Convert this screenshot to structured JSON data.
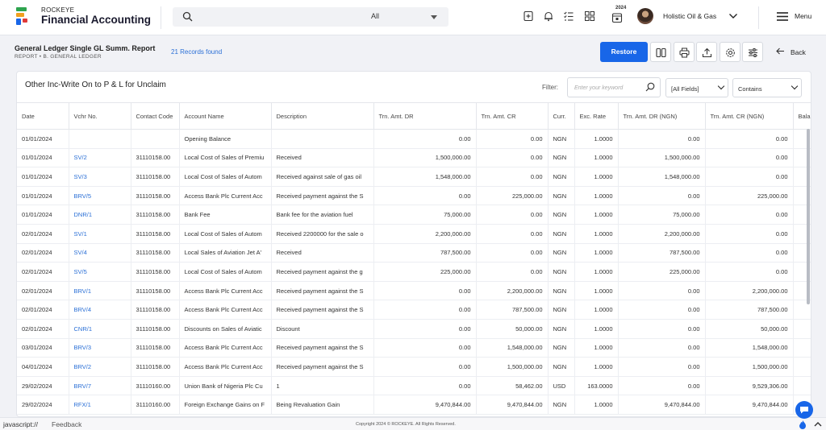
{
  "app": {
    "company_small": "ROCKEYE",
    "name": "Financial Accounting"
  },
  "search": {
    "filter_value": "All"
  },
  "header": {
    "year": "2024",
    "company": "Holistic Oil & Gas",
    "menu_label": "Menu"
  },
  "page": {
    "title": "General Ledger Single GL Summ. Report",
    "breadcrumb": "REPORT  •  B. GENERAL LEDGER",
    "records": "21 Records found",
    "restore_label": "Restore",
    "back_label": "Back"
  },
  "report": {
    "title": "Other Inc-Write On to P & L for Unclaim",
    "filter_label": "Filter:",
    "filter_placeholder": "Enter your keyword",
    "field_select": "[All Fields]",
    "match_select": "Contains"
  },
  "table": {
    "columns": [
      "Date",
      "Vchr No.",
      "Contact Code",
      "Account Name",
      "Description",
      "Trn. Amt. DR",
      "Trn. Amt. CR",
      "Curr.",
      "Exc. Rate",
      "Trn. Amt. DR (NGN)",
      "Trn. Amt. CR (NGN)",
      "Balar"
    ],
    "rows": [
      [
        "01/01/2024",
        "",
        "",
        "Opening Balance",
        "",
        "0.00",
        "0.00",
        "NGN",
        "1.0000",
        "0.00",
        "0.00"
      ],
      [
        "01/01/2024",
        "SV/2",
        "31110158.00",
        "Local Cost of Sales of Premiu",
        "Received",
        "1,500,000.00",
        "0.00",
        "NGN",
        "1.0000",
        "1,500,000.00",
        "0.00"
      ],
      [
        "01/01/2024",
        "SV/3",
        "31110158.00",
        "Local Cost of Sales of Autom",
        "Received against sale of gas oil",
        "1,548,000.00",
        "0.00",
        "NGN",
        "1.0000",
        "1,548,000.00",
        "0.00"
      ],
      [
        "01/01/2024",
        "BRV/5",
        "31110158.00",
        "Access Bank Plc Current Acc",
        "Received payment against the S",
        "0.00",
        "225,000.00",
        "NGN",
        "1.0000",
        "0.00",
        "225,000.00"
      ],
      [
        "01/01/2024",
        "DNR/1",
        "31110158.00",
        "Bank Fee",
        "Bank fee for the aviation fuel",
        "75,000.00",
        "0.00",
        "NGN",
        "1.0000",
        "75,000.00",
        "0.00"
      ],
      [
        "02/01/2024",
        "SV/1",
        "31110158.00",
        "Local Cost of Sales of Autom",
        "Received 2200000 for the sale o",
        "2,200,000.00",
        "0.00",
        "NGN",
        "1.0000",
        "2,200,000.00",
        "0.00"
      ],
      [
        "02/01/2024",
        "SV/4",
        "31110158.00",
        "Local Sales of Aviation Jet A'",
        "Received",
        "787,500.00",
        "0.00",
        "NGN",
        "1.0000",
        "787,500.00",
        "0.00"
      ],
      [
        "02/01/2024",
        "SV/5",
        "31110158.00",
        "Local Cost of Sales of Autom",
        "Received payment against the g",
        "225,000.00",
        "0.00",
        "NGN",
        "1.0000",
        "225,000.00",
        "0.00"
      ],
      [
        "02/01/2024",
        "BRV/1",
        "31110158.00",
        "Access Bank Plc Current Acc",
        "Received payment against the S",
        "0.00",
        "2,200,000.00",
        "NGN",
        "1.0000",
        "0.00",
        "2,200,000.00"
      ],
      [
        "02/01/2024",
        "BRV/4",
        "31110158.00",
        "Access Bank Plc Current Acc",
        "Received payment against the S",
        "0.00",
        "787,500.00",
        "NGN",
        "1.0000",
        "0.00",
        "787,500.00"
      ],
      [
        "02/01/2024",
        "CNR/1",
        "31110158.00",
        "Discounts on Sales of Aviatic",
        "Discount",
        "0.00",
        "50,000.00",
        "NGN",
        "1.0000",
        "0.00",
        "50,000.00"
      ],
      [
        "03/01/2024",
        "BRV/3",
        "31110158.00",
        "Access Bank Plc Current Acc",
        "Received payment against the S",
        "0.00",
        "1,548,000.00",
        "NGN",
        "1.0000",
        "0.00",
        "1,548,000.00"
      ],
      [
        "04/01/2024",
        "BRV/2",
        "31110158.00",
        "Access Bank Plc Current Acc",
        "Received payment against the S",
        "0.00",
        "1,500,000.00",
        "NGN",
        "1.0000",
        "0.00",
        "1,500,000.00"
      ],
      [
        "29/02/2024",
        "BRV/7",
        "31110160.00",
        "Union Bank of Nigeria Plc Cu",
        "1",
        "0.00",
        "58,462.00",
        "USD",
        "163.0000",
        "0.00",
        "9,529,306.00"
      ],
      [
        "29/02/2024",
        "RFX/1",
        "31110160.00",
        "Foreign Exchange Gains on F",
        "Being Revaluation Gain",
        "9,470,844.00",
        "9,470,844.00",
        "NGN",
        "1.0000",
        "9,470,844.00",
        "9,470,844.00"
      ]
    ]
  },
  "footer": {
    "status": "javascript://",
    "feedback": "Feedback",
    "copyright": "Copyright 2024 © ROCKEYE. All Rights Reserved."
  },
  "colors": {
    "primary": "#1866e8",
    "link": "#2a6fd6"
  }
}
